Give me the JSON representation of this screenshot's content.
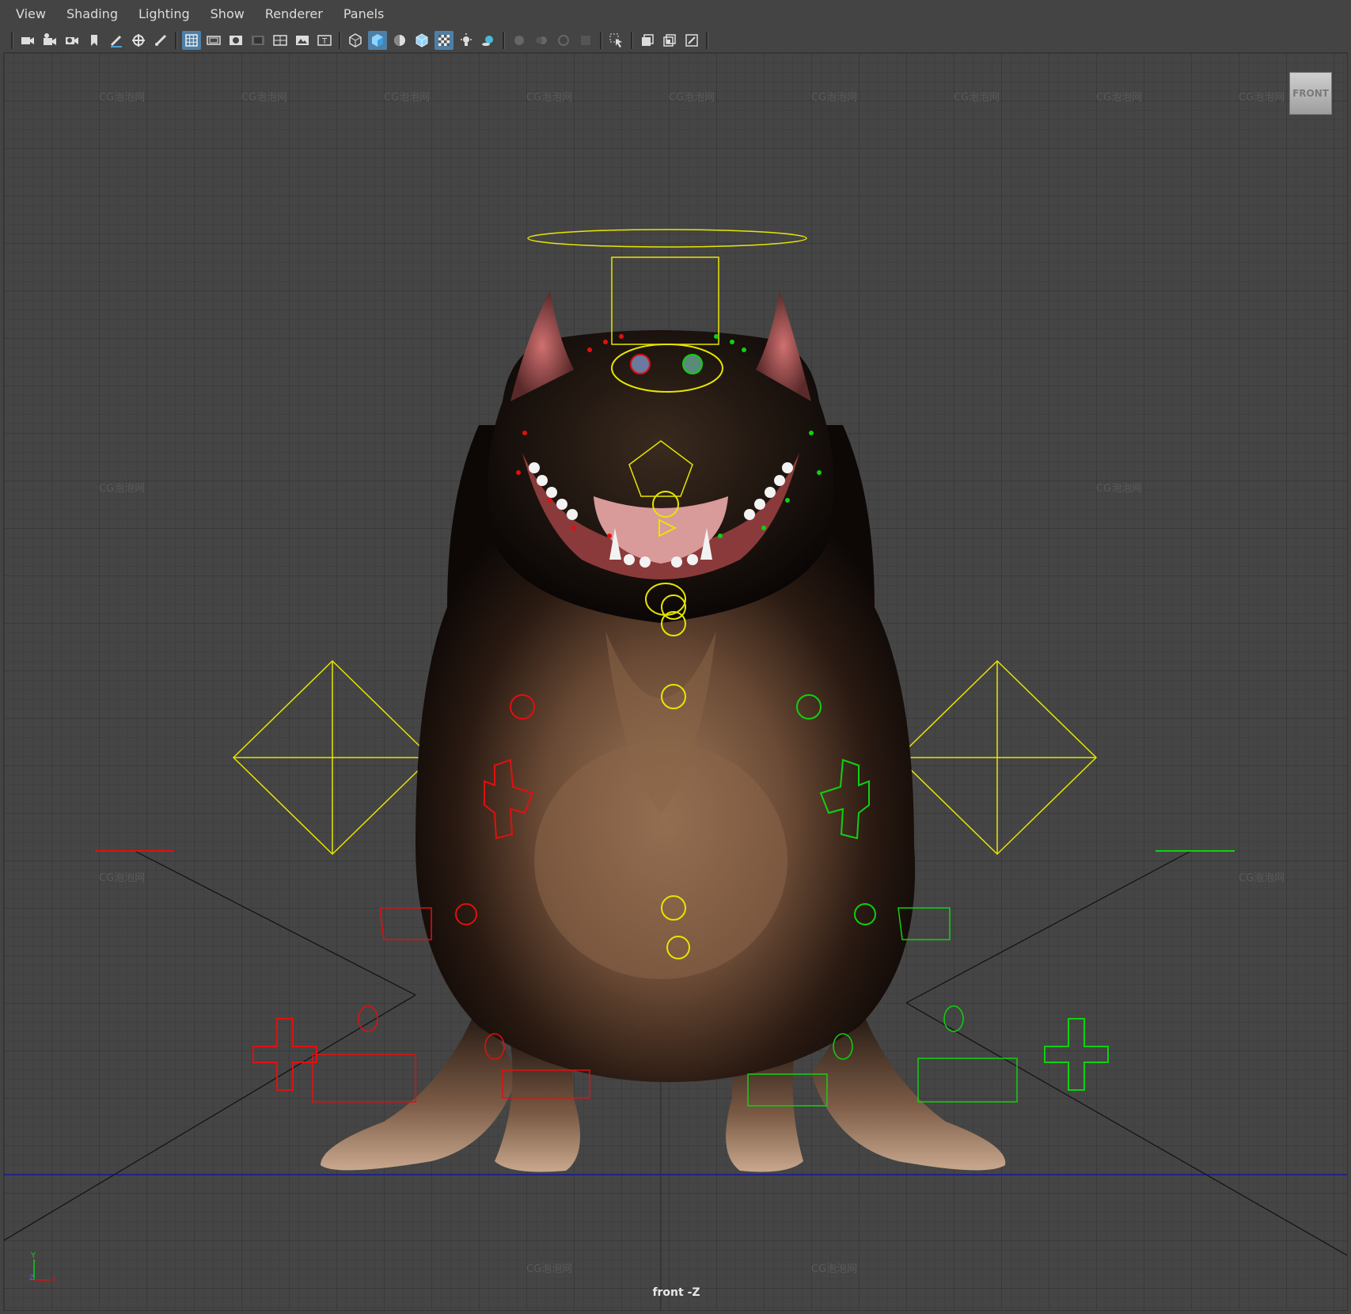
{
  "menu": {
    "items": [
      {
        "label": "View"
      },
      {
        "label": "Shading"
      },
      {
        "label": "Lighting"
      },
      {
        "label": "Show"
      },
      {
        "label": "Renderer"
      },
      {
        "label": "Panels"
      }
    ]
  },
  "toolbar": {
    "icons": [
      "select-camera-icon",
      "camera-attributes-icon",
      "image-plane-icon",
      "bookmark-icon",
      "grease-pencil-icon",
      "2d-pan-zoom-icon",
      "camera-lock-icon",
      "grid-icon",
      "film-gate-icon",
      "resolution-gate-icon",
      "gate-mask-icon",
      "field-chart-icon",
      "safe-action-icon",
      "safe-title-icon",
      "wireframe-icon",
      "smooth-shade-icon",
      "default-material-icon",
      "wireframe-on-shaded-icon",
      "xray-icon",
      "use-all-lights-icon",
      "shadows-icon",
      "ambient-occlusion-icon",
      "motion-blur-icon",
      "multisample-aa-icon",
      "depth-of-field-icon",
      "isolate-select-icon",
      "xray-joints-icon",
      "xray-active-icon",
      "backface-culling-icon"
    ],
    "active_icons": [
      "grid-icon",
      "smooth-shade-icon",
      "xray-icon"
    ]
  },
  "viewport": {
    "view_cube_label": "FRONT",
    "camera_label": "front -Z",
    "watermark": "CG泡泡网",
    "axis": {
      "y": "Y",
      "z": "Z",
      "x": "X"
    }
  },
  "colors": {
    "background": "#444444",
    "grid": "#3a3a3a",
    "ctrl_yellow": "#e6e600",
    "ctrl_red": "#e01010",
    "ctrl_green": "#10d010",
    "horizon": "#1a1aa0",
    "active_tool": "#4e7fa6"
  }
}
